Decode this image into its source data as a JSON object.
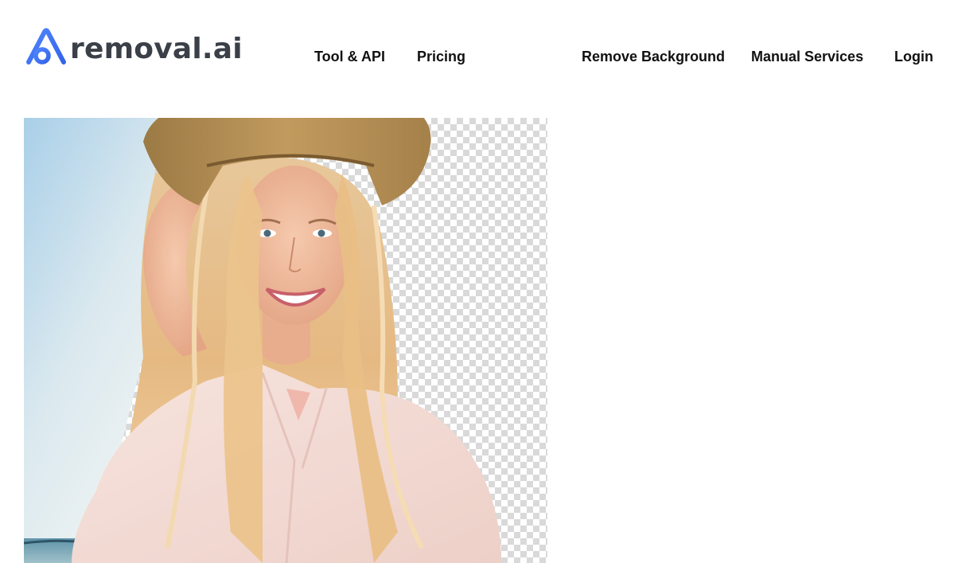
{
  "brand": {
    "name": "removal.ai",
    "logo_icon": "removal-ai-logo-icon",
    "text_color": "#3b3f48",
    "accent": "#3b6ff5"
  },
  "nav": {
    "left": [
      {
        "label": "Tool & API"
      },
      {
        "label": "Pricing"
      }
    ],
    "right": [
      {
        "label": "Remove Background"
      },
      {
        "label": "Manual Services"
      },
      {
        "label": "Login"
      }
    ]
  },
  "hero": {
    "image": "woman-in-hat-background-removal-preview",
    "left_background": "sky-and-sea-photo",
    "right_background": "transparency-checkerboard"
  }
}
